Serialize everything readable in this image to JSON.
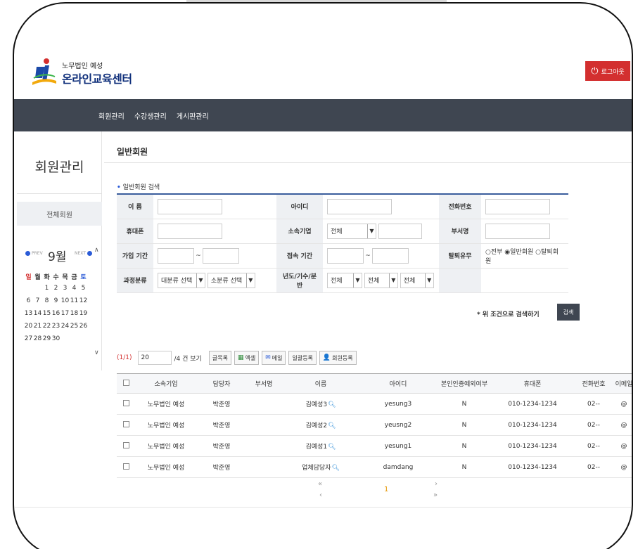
{
  "header": {
    "logo_small": "노무법인 예성",
    "logo_big": "온라인교육센터",
    "logout_label": "로그아웃"
  },
  "nav": {
    "items": [
      "회원관리",
      "수강생관리",
      "게시판관리"
    ]
  },
  "sidebar": {
    "title": "회원관리",
    "item": "전체회원"
  },
  "calendar": {
    "prev": "PREV",
    "month": "9월",
    "next": "NEXT",
    "dow": [
      "일",
      "월",
      "화",
      "수",
      "목",
      "금",
      "토"
    ],
    "weeks": [
      [
        "",
        "",
        "1",
        "2",
        "3",
        "4",
        "5"
      ],
      [
        "6",
        "7",
        "8",
        "9",
        "10",
        "11",
        "12"
      ],
      [
        "13",
        "14",
        "15",
        "16",
        "17",
        "18",
        "19"
      ],
      [
        "20",
        "21",
        "22",
        "23",
        "24",
        "25",
        "26"
      ],
      [
        "27",
        "28",
        "29",
        "30",
        "",
        "",
        ""
      ]
    ]
  },
  "main": {
    "title": "일반회원",
    "search_label": "일반회원 검색",
    "fields": {
      "name": "이 름",
      "id": "아이디",
      "phone_no": "전화번호",
      "mobile": "휴대폰",
      "company": "소속기업",
      "company_select": "전체",
      "dept": "부서명",
      "join_period": "가입 기간",
      "access_period": "접속 기간",
      "withdraw": "탈퇴유무",
      "withdraw_opts": [
        "전부",
        "일반회원",
        "탈퇴회원"
      ],
      "course": "과정분류",
      "course_major": "대분류 선택",
      "course_minor": "소분류 선택",
      "year_label": "년도/기수/분반",
      "year_all": "전체",
      "term_all": "전체",
      "class_all": "전체"
    },
    "search_hint": "* 위 조건으로 검색하기",
    "search_button": "검색"
  },
  "toolbar": {
    "count": "(1/1)",
    "per_page": "20",
    "per_page_suffix": "/4 건 보기",
    "buttons": [
      "글목록",
      "엑셀",
      "메일",
      "일괄등록",
      "회원등록"
    ]
  },
  "list": {
    "columns": [
      "",
      "소속기업",
      "담당자",
      "부서명",
      "이름",
      "아이디",
      "본인인증예외여부",
      "휴대폰",
      "전화번호",
      "이메일"
    ],
    "rows": [
      {
        "company": "노무법인 예성",
        "manager": "박준영",
        "dept": "",
        "name": "김예성3",
        "id": "yesung3",
        "exempt": "N",
        "mobile": "010-1234-1234",
        "phone": "02--",
        "email": "@"
      },
      {
        "company": "노무법인 예성",
        "manager": "박준영",
        "dept": "",
        "name": "김예성2",
        "id": "yeusng2",
        "exempt": "N",
        "mobile": "010-1234-1234",
        "phone": "02--",
        "email": "@"
      },
      {
        "company": "노무법인 예성",
        "manager": "박준영",
        "dept": "",
        "name": "김예성1",
        "id": "yesung1",
        "exempt": "N",
        "mobile": "010-1234-1234",
        "phone": "02--",
        "email": "@"
      },
      {
        "company": "노무법인 예성",
        "manager": "박준영",
        "dept": "",
        "name": "업체담당자",
        "id": "damdang",
        "exempt": "N",
        "mobile": "010-1234-1234",
        "phone": "02--",
        "email": "@"
      }
    ]
  },
  "pager": {
    "first": "«",
    "prev": "‹",
    "current": "1",
    "next": "›",
    "last": "»"
  }
}
